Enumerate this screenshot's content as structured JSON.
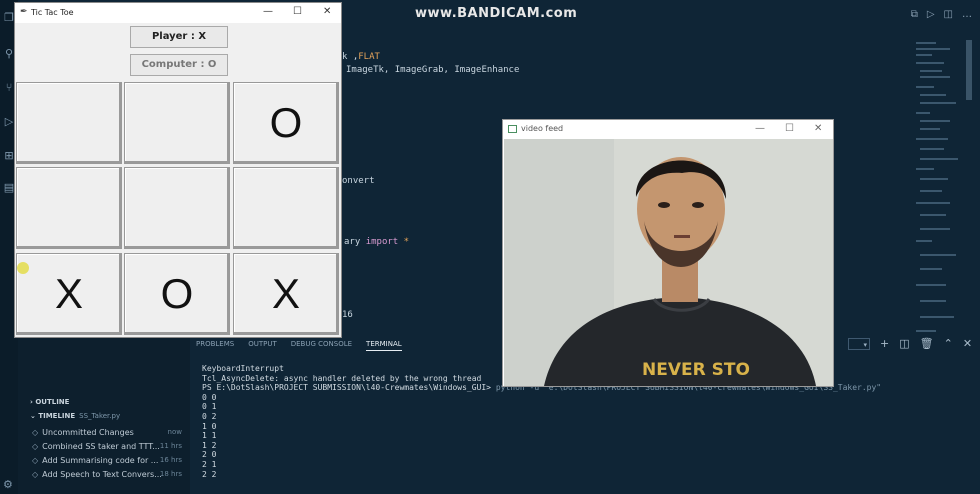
{
  "watermark": "www.BANDICAM.com",
  "code_lines": [
    {
      "a": "k ,",
      "b": "FLAT"
    },
    {
      "a": "ImageTk, ImageGrab, ImageEnhance"
    },
    {
      "a": "onvert"
    },
    {
      "a": "ary ",
      "b": "import",
      "c": " *"
    },
    {
      "a": "16"
    }
  ],
  "panel": {
    "tabs": [
      "PROBLEMS",
      "OUTPUT",
      "DEBUG CONSOLE",
      "TERMINAL"
    ],
    "active_tab": "TERMINAL"
  },
  "terminal": {
    "lines": [
      "KeyboardInterrupt",
      "Tcl_AsyncDelete: async handler deleted by the wrong thread"
    ],
    "prompt": "PS E:\\DotSlash\\PROJECT SUBMISSION\\l40-Crewmates\\Windows_GUI> ",
    "command": "python -u \"e:\\DotSlash\\PROJECT SUBMISSION\\l40-Crewmates\\Windows_GUI\\SS_Taker.py\"",
    "output": [
      "0 0",
      "0 1",
      "0 2",
      "1 0",
      "1 1",
      "1 2",
      "2 0",
      "2 1",
      "2 2"
    ]
  },
  "sidebar": {
    "outline_label": "OUTLINE",
    "timeline_label": "TIMELINE",
    "timeline_file": "SS_Taker.py",
    "timeline_items": [
      {
        "label": "Uncommitted Changes",
        "when": "now"
      },
      {
        "label": "Combined SS taker and TTT...",
        "when": "11 hrs"
      },
      {
        "label": "Add Summarising code for ...",
        "when": "16 hrs"
      },
      {
        "label": "Add Speech to Text Convers...",
        "when": "18 hrs"
      }
    ]
  },
  "tictactoe": {
    "title": "Tic Tac Toe",
    "player_label": "Player : X",
    "computer_label": "Computer : O",
    "board": [
      "",
      "",
      "O",
      "",
      "",
      "",
      "X",
      "O",
      "X"
    ]
  },
  "video": {
    "title": "video feed",
    "shirt_text": "NEVER STO"
  }
}
